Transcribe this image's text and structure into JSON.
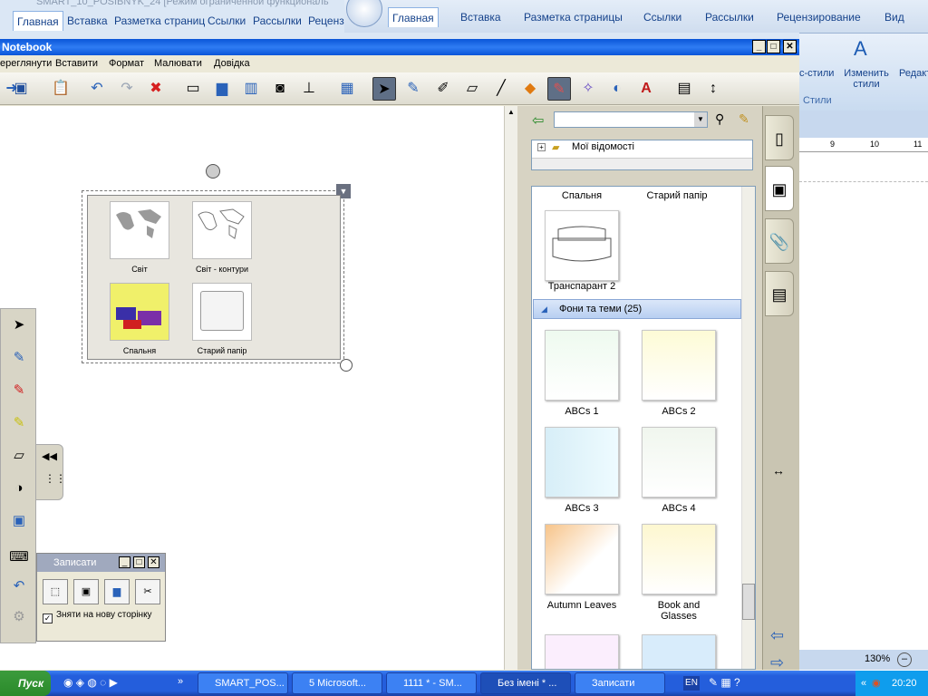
{
  "word_left": {
    "doc_title": "SMART_10_POSIBNYK_24 [Режим ограниченной функциональ",
    "tabs": [
      "Главная",
      "Вставка",
      "Разметка страниц",
      "Ссылки",
      "Рассылки",
      "Рецензи"
    ]
  },
  "word_right": {
    "tabs": [
      "Главная",
      "Вставка",
      "Разметка страницы",
      "Ссылки",
      "Рассылки",
      "Рецензирование",
      "Вид"
    ],
    "styles_label": "с-стили",
    "change_styles": "Изменить стили",
    "edit_label": "Редакт",
    "styles_group": "Стили",
    "ruler": [
      "9",
      "10",
      "11"
    ],
    "zoom": "130%"
  },
  "notebook": {
    "title": "Notebook",
    "menu": [
      "ереглянути",
      "Вставити",
      "Формат",
      "Малювати",
      "Довідка"
    ]
  },
  "selected_object": {
    "items": [
      "Світ",
      "Світ - контури",
      "Спальня",
      "Старий папір"
    ]
  },
  "gallery": {
    "tree_root": "Мої відомості",
    "top_labels": [
      "Спальня",
      "Старий папір"
    ],
    "banner_item": "Транспарант 2",
    "category": "Фони та теми (25)",
    "items": [
      "ABCs 1",
      "ABCs 2",
      "ABCs 3",
      "ABCs 4",
      "Autumn Leaves",
      "Book and Glasses"
    ]
  },
  "recorder": {
    "title": "Записати",
    "checkbox_label": "Зняти на нову сторінку"
  },
  "taskbar": {
    "start": "Пуск",
    "tasks": [
      "SMART_POS...",
      "5 Microsoft...",
      "1111 * - SM...",
      "Без імені * ...",
      "Записати"
    ],
    "lang": "EN",
    "time": "20:20"
  }
}
